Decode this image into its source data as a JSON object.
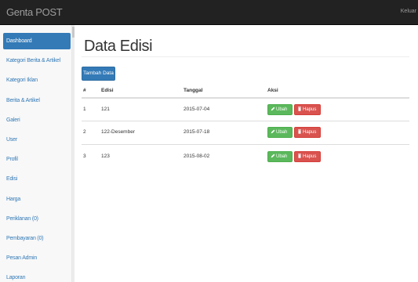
{
  "navbar": {
    "brand": "Genta POST",
    "logout": "Keluar"
  },
  "sidebar": {
    "items": [
      {
        "label": "Dashboard"
      },
      {
        "label": "Kategori Berita & Artikel"
      },
      {
        "label": "Kategori Iklan"
      },
      {
        "label": "Berita & Artikel"
      },
      {
        "label": "Galeri"
      },
      {
        "label": "User"
      },
      {
        "label": "Profil"
      },
      {
        "label": "Edisi"
      },
      {
        "label": "Harga"
      },
      {
        "label": "Periklanan (0)"
      },
      {
        "label": "Pembayaran (0)"
      },
      {
        "label": "Pesan Admin"
      },
      {
        "label": "Laporan"
      }
    ],
    "active_index": 0
  },
  "main": {
    "title": "Data Edisi",
    "add_button": "Tambah Data",
    "table": {
      "headers": [
        "#",
        "Edisi",
        "Tanggal",
        "Aksi"
      ],
      "rows": [
        {
          "no": "1",
          "edisi": "121",
          "tanggal": "2015-07-04"
        },
        {
          "no": "2",
          "edisi": "122-Desember",
          "tanggal": "2015-07-18"
        },
        {
          "no": "3",
          "edisi": "123",
          "tanggal": "2015-08-02"
        }
      ],
      "edit_label": "Ubah",
      "delete_label": "Hapus"
    }
  },
  "colors": {
    "navbar": "#222222",
    "primary": "#337ab7",
    "success": "#5cb85c",
    "danger": "#d9534f"
  },
  "icons": {
    "edit": "pencil-icon",
    "delete": "trash-icon"
  }
}
